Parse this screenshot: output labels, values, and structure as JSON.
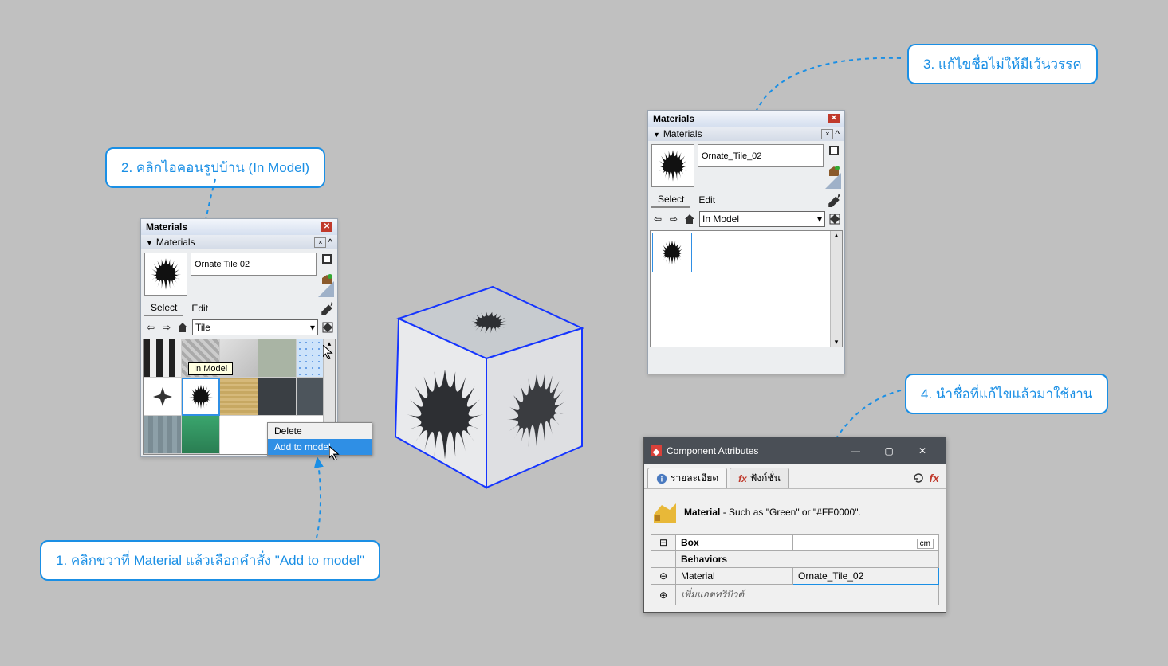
{
  "callouts": {
    "c1": "1. คลิกขวาที่ Material แล้วเลือกคำสั่ง \"Add to model\"",
    "c2": "2. คลิกไอคอนรูปบ้าน (In Model)",
    "c3": "3. แก้ไขชื่อไม่ให้มีเว้นวรรค",
    "c4": "4. นำชื่อที่แก้ไขแล้วมาใช้งาน"
  },
  "materials_panel1": {
    "title": "Materials",
    "subtitle": "Materials",
    "current_name": "Ornate Tile 02",
    "tabs": {
      "select": "Select",
      "edit": "Edit"
    },
    "folder": "Tile",
    "tooltip": "In Model",
    "context": {
      "delete": "Delete",
      "add": "Add to model"
    }
  },
  "materials_panel2": {
    "title": "Materials",
    "subtitle": "Materials",
    "current_name": "Ornate_Tile_02",
    "tabs": {
      "select": "Select",
      "edit": "Edit"
    },
    "folder": "In Model"
  },
  "component_attributes": {
    "title": "Component Attributes",
    "tab_details": "รายละเอียด",
    "tab_functions": "ฟังก์ชั่น",
    "material_label": "Material",
    "material_desc": "Such as \"Green\" or \"#FF0000\".",
    "box": "Box",
    "behaviors": "Behaviors",
    "row_material": "Material",
    "row_material_value": "Ornate_Tile_02",
    "add_attr": "เพิ่มแอตทริบิวต์",
    "unit": "cm"
  }
}
